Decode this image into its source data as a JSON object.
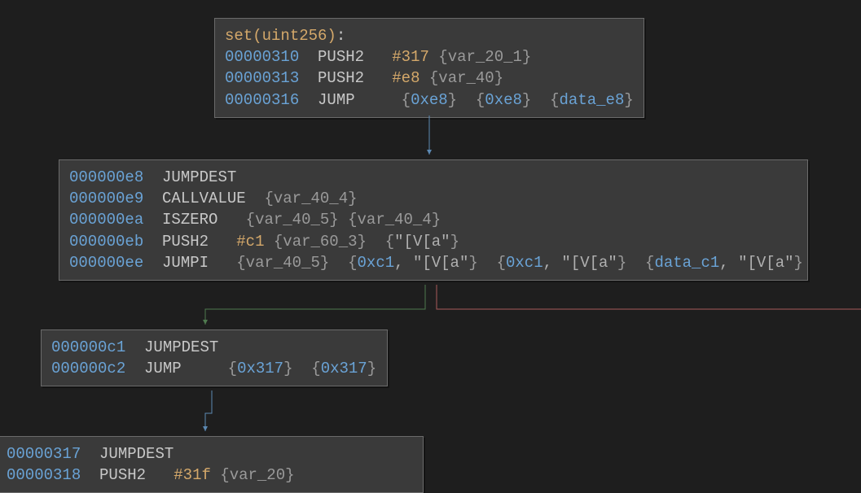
{
  "block1": {
    "func_sig": "set(uint256)",
    "l1": {
      "addr": "00000310",
      "op": "PUSH2",
      "imm": "#317",
      "var1": "var_20_1"
    },
    "l2": {
      "addr": "00000313",
      "op": "PUSH2",
      "imm": "#e8",
      "var1": "var_40"
    },
    "l3": {
      "addr": "00000316",
      "op": "JUMP",
      "h1": "0xe8",
      "h2": "0xe8",
      "d1": "data_e8"
    }
  },
  "block2": {
    "l1": {
      "addr": "000000e8",
      "op": "JUMPDEST"
    },
    "l2": {
      "addr": "000000e9",
      "op": "CALLVALUE",
      "var1": "var_40_4"
    },
    "l3": {
      "addr": "000000ea",
      "op": "ISZERO",
      "var1": "var_40_5",
      "var2": "var_40_4"
    },
    "l4": {
      "addr": "000000eb",
      "op": "PUSH2",
      "imm": "#c1",
      "var1": "var_60_3",
      "txt1": "\"[V[a\""
    },
    "l5": {
      "addr": "000000ee",
      "op": "JUMPI",
      "var1": "var_40_5",
      "h1": "0xc1",
      "t1": "\"[V[a\"",
      "h2": "0xc1",
      "t2": "\"[V[a\"",
      "d1": "data_c1",
      "t3": "\"[V[a\""
    }
  },
  "block3": {
    "l1": {
      "addr": "000000c1",
      "op": "JUMPDEST"
    },
    "l2": {
      "addr": "000000c2",
      "op": "JUMP",
      "h1": "0x317",
      "h2": "0x317"
    }
  },
  "block4": {
    "l1": {
      "addr": "00000317",
      "op": "JUMPDEST"
    },
    "l2": {
      "addr": "00000318",
      "op": "PUSH2",
      "imm": "#31f",
      "var1": "var_20"
    }
  }
}
